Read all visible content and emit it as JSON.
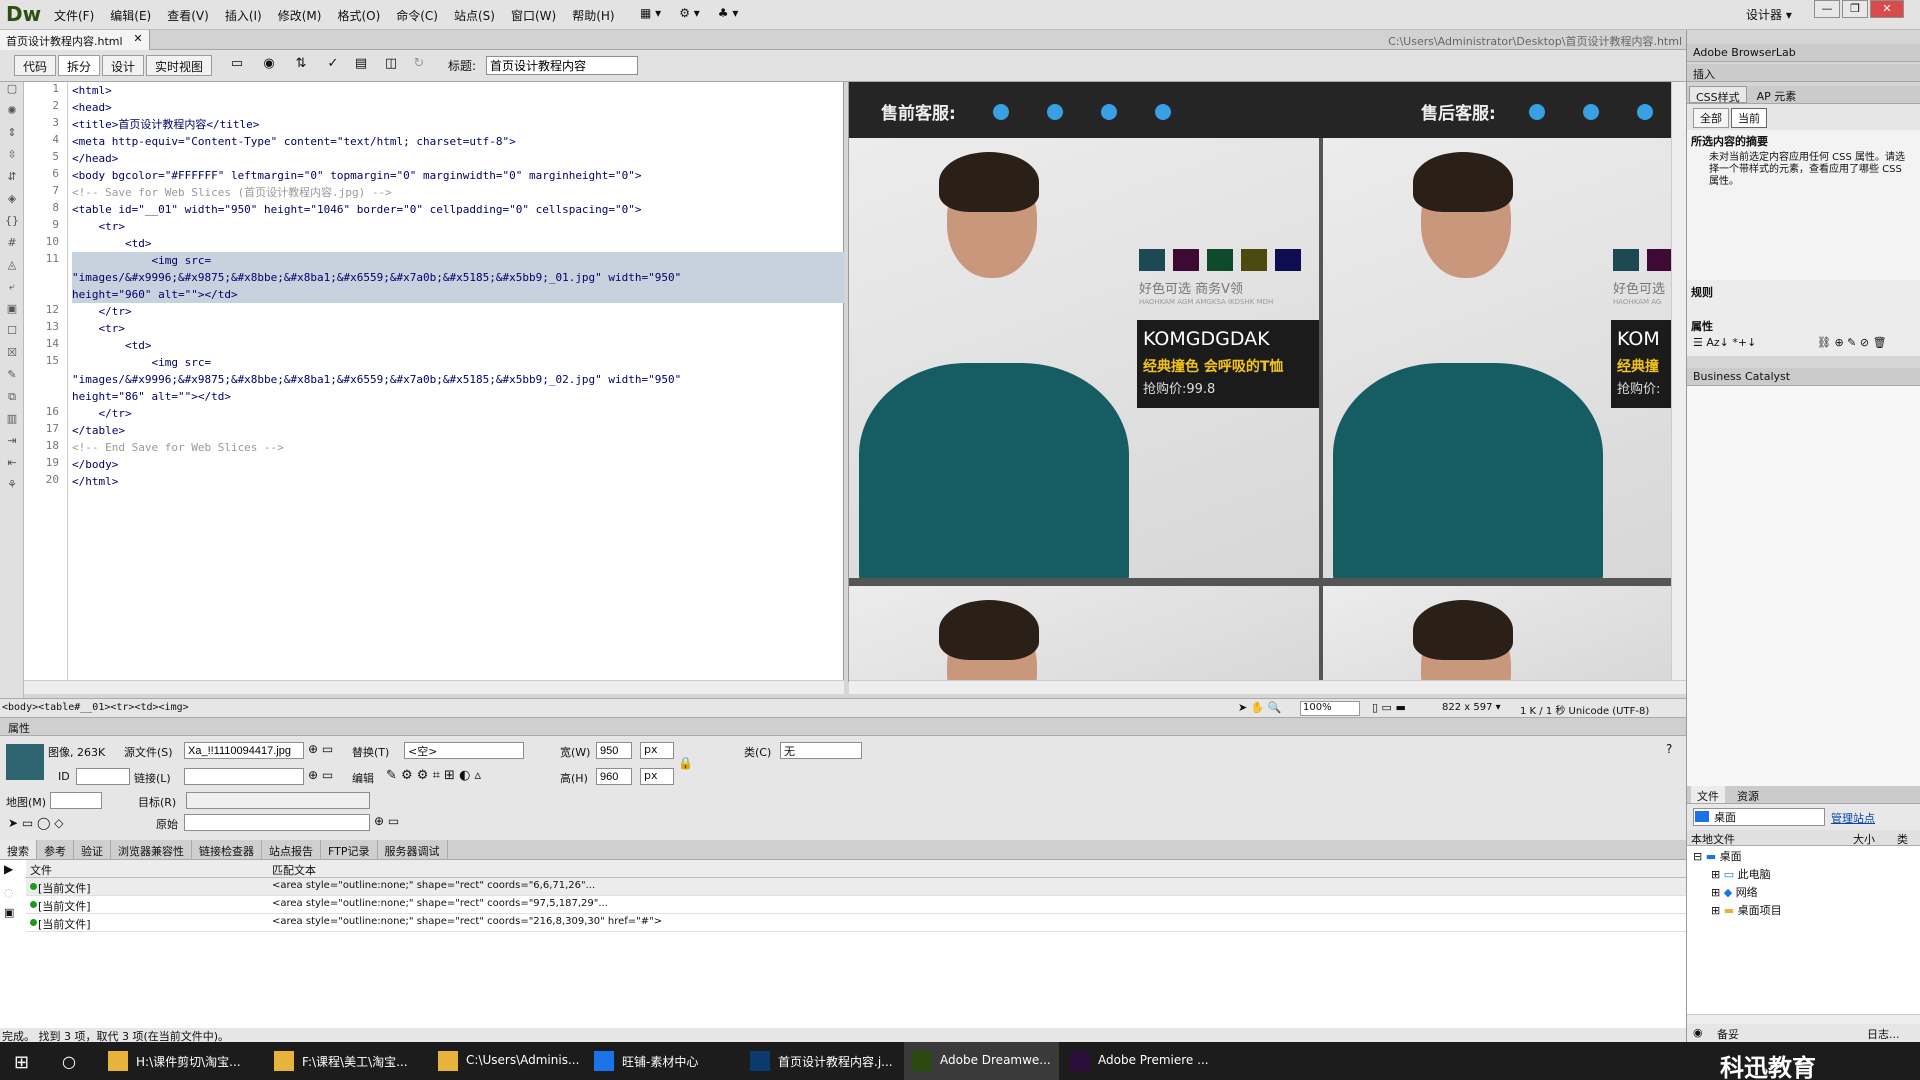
{
  "app": {
    "logo": "Dw",
    "workspace": "设计器 ▾"
  },
  "menu": [
    "文件(F)",
    "编辑(E)",
    "查看(V)",
    "插入(I)",
    "修改(M)",
    "格式(O)",
    "命令(C)",
    "站点(S)",
    "窗口(W)",
    "帮助(H)"
  ],
  "doc": {
    "tab": "首页设计教程内容.html",
    "path": "C:\\Users\\Administrator\\Desktop\\首页设计教程内容.html"
  },
  "toolbar": {
    "code": "代码",
    "split": "拆分",
    "design": "设计",
    "live": "实时视图",
    "title_label": "标题:",
    "title_value": "首页设计教程内容"
  },
  "code_lines": [
    "<html>",
    "<head>",
    "<title>首页设计教程内容</title>",
    "<meta http-equiv=\"Content-Type\" content=\"text/html; charset=utf-8\">",
    "</head>",
    "<body bgcolor=\"#FFFFFF\" leftmargin=\"0\" topmargin=\"0\" marginwidth=\"0\" marginheight=\"0\">",
    "<!-- Save for Web Slices (首页设计教程内容.jpg) -->",
    "<table id=\"__01\" width=\"950\" height=\"1046\" border=\"0\" cellpadding=\"0\" cellspacing=\"0\">",
    "    <tr>",
    "        <td>",
    "            <img src=",
    "\"images/&#x9996;&#x9875;&#x8bbe;&#x8ba1;&#x6559;&#x7a0b;&#x5185;&#x5bb9;_01.jpg\" width=\"950\"",
    "height=\"960\" alt=\"\"></td>",
    "    </tr>",
    "    <tr>",
    "        <td>",
    "            <img src=",
    "\"images/&#x9996;&#x9875;&#x8bbe;&#x8ba1;&#x6559;&#x7a0b;&#x5185;&#x5bb9;_02.jpg\" width=\"950\"",
    "height=\"86\" alt=\"\"></td>",
    "    </tr>",
    "</table>",
    "<!-- End Save for Web Slices -->",
    "</body>",
    "</html>"
  ],
  "line_numbers": [
    "1",
    "2",
    "3",
    "4",
    "5",
    "6",
    "7",
    "8",
    "9",
    "10",
    "11",
    "",
    "",
    "12",
    "13",
    "14",
    "15",
    "",
    "",
    "16",
    "17",
    "18",
    "19",
    "20"
  ],
  "design": {
    "presale": "售前客服:",
    "aftersale": "售后客服:",
    "options": "好色可选  商务V领",
    "small": "HAOHKAM AGM AMGKSA IKDSHK MDH",
    "brand": "KOMGDGDAK",
    "slogan": "经典撞色  会呼吸的T恤",
    "price": "抢购价:99.8",
    "brand_cut": "KOM",
    "slogan_cut": "经典撞",
    "price_cut": "抢购价:",
    "options_cut": "好色可选",
    "small_cut": "HAOHKAM AG",
    "swatches": [
      "#1d4a52",
      "#3d0a35",
      "#0f4a2c",
      "#4d4a10",
      "#0d0d50"
    ]
  },
  "tagbar": {
    "path": "<body><table#__01><tr><td><img>",
    "zoom": "100%",
    "size": "822 x 597 ▾",
    "info": "1 K / 1 秒  Unicode (UTF-8)"
  },
  "props": {
    "header": "属性",
    "img_label": "图像, 263K",
    "src_label": "源文件(S)",
    "src_value": "Xa_!!1110094417.jpg",
    "alt_label": "替换(T)",
    "alt_value": "<空>",
    "w_label": "宽(W)",
    "w_value": "950",
    "h_label": "高(H)",
    "h_value": "960",
    "unit": "px",
    "class_label": "类(C)",
    "class_value": "无",
    "id_label": "ID",
    "link_label": "链接(L)",
    "edit_label": "编辑",
    "map_label": "地图(M)",
    "target_label": "目标(R)",
    "orig_label": "原始"
  },
  "results": {
    "tabs": [
      "搜索",
      "参考",
      "验证",
      "浏览器兼容性",
      "链接检查器",
      "站点报告",
      "FTP记录",
      "服务器调试"
    ],
    "col_file": "文件",
    "col_match": "匹配文本",
    "rows": [
      {
        "file": "[当前文件]",
        "text": "<area style=\"outline:none;\" shape=\"rect\" coords=\"6,6,71,26\"..."
      },
      {
        "file": "[当前文件]",
        "text": "<area style=\"outline:none;\" shape=\"rect\" coords=\"97,5,187,29\"..."
      },
      {
        "file": "[当前文件]",
        "text": "<area style=\"outline:none;\" shape=\"rect\" coords=\"216,8,309,30\" href=\"#\">"
      }
    ],
    "status": "完成。  找到 3 项，取代 3 项(在当前文件中)。"
  },
  "right": {
    "browserlab": "Adobe BrowserLab",
    "insert": "插入",
    "css_tab": "CSS样式",
    "ap_tab": "AP 元素",
    "all": "全部",
    "current": "当前",
    "summary_title": "所选内容的摘要",
    "summary_text": "未对当前选定内容应用任何 CSS 属性。请选择一个带样式的元素，查看应用了哪些 CSS 属性。",
    "rules": "规则",
    "props_label": "属性",
    "catalyst": "Business Catalyst",
    "files_tab": "文件",
    "assets_tab": "资源",
    "location": "桌面",
    "manage": "管理站点",
    "col_local": "本地文件",
    "col_size": "大小",
    "col_type": "类",
    "tree": [
      "桌面",
      "此电脑",
      "网络",
      "桌面项目"
    ],
    "bottom_left": "备妥",
    "bottom_right": "日志..."
  },
  "taskbar": [
    {
      "label": "H:\\课件剪切\\淘宝...",
      "color": "#e8b33a"
    },
    {
      "label": "F:\\课程\\美工\\淘宝...",
      "color": "#e8b33a"
    },
    {
      "label": "C:\\Users\\Adminis...",
      "color": "#e8b33a"
    },
    {
      "label": "旺铺-素材中心",
      "color": "#1a73e8"
    },
    {
      "label": "首页设计教程内容.j...",
      "color": "#0b3a6e"
    },
    {
      "label": "Adobe Dreamwe...",
      "color": "#2c4a10"
    },
    {
      "label": "Adobe Premiere ...",
      "color": "#2a0f3c"
    }
  ],
  "watermark": "科迅教育"
}
